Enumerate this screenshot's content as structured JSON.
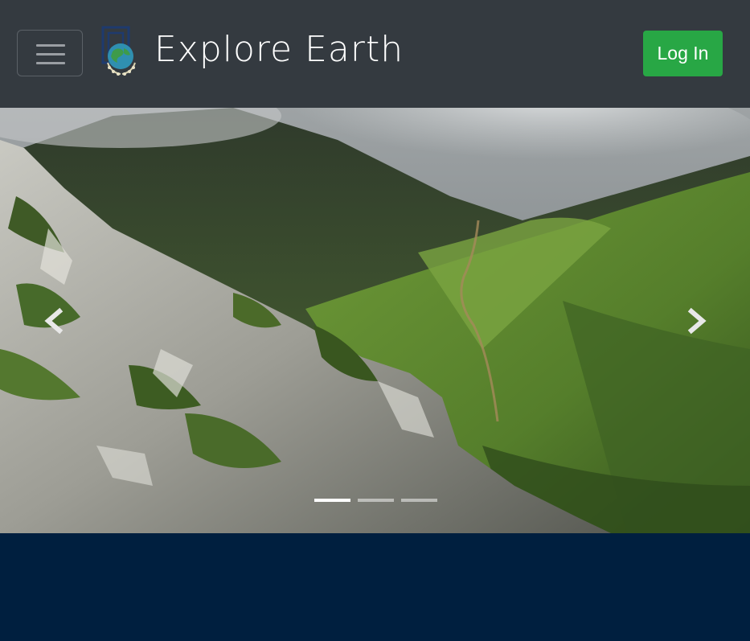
{
  "header": {
    "brand_name": "Explore Earth",
    "logo_icon": "globe-laurel-logo-icon",
    "menu_icon": "hamburger-menu-icon",
    "login_label": "Log In",
    "colors": {
      "navbar_bg": "#343a40",
      "login_bg": "#28a745"
    }
  },
  "carousel": {
    "slide_image": "mountain-landscape-photo",
    "prev_icon": "chevron-left-icon",
    "next_icon": "chevron-right-icon",
    "indicator_count": 3,
    "active_indicator": 1
  },
  "footer": {
    "color": "#001f3f"
  }
}
